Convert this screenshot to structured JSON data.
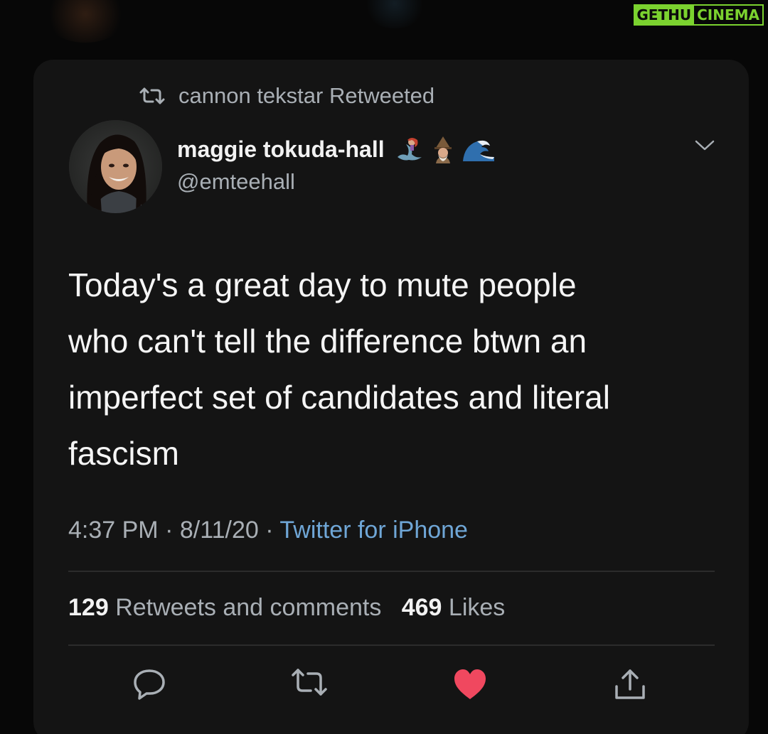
{
  "watermark": {
    "part_a": "GETHU",
    "part_b": "CINEMA"
  },
  "retweet": {
    "text": "cannon tekstar Retweeted",
    "icon": "retweet-icon"
  },
  "author": {
    "name": "maggie tokuda-hall",
    "handle": "@emteehall",
    "emojis": [
      "mermaid-emoji",
      "mage-emoji",
      "wave-emoji"
    ]
  },
  "tweet": {
    "lines": [
      "Today's a great day to mute people",
      "who can't tell the difference btwn an",
      "imperfect set of candidates and literal",
      "fascism"
    ]
  },
  "meta": {
    "time": "4:37 PM",
    "date": "8/11/20",
    "separator": "·",
    "source": "Twitter for iPhone"
  },
  "stats": {
    "retweets_count": "129",
    "retweets_label": "Retweets and comments",
    "likes_count": "469",
    "likes_label": "Likes"
  },
  "actions": {
    "icons": [
      "reply-icon",
      "retweet-icon",
      "like-icon",
      "share-icon"
    ],
    "like_color": "#f0485f",
    "icon_color": "#a9afb5"
  },
  "colors": {
    "background": "#070707",
    "card": "#141414",
    "link": "#6fa6d6",
    "watermark": "#7bd22f"
  }
}
